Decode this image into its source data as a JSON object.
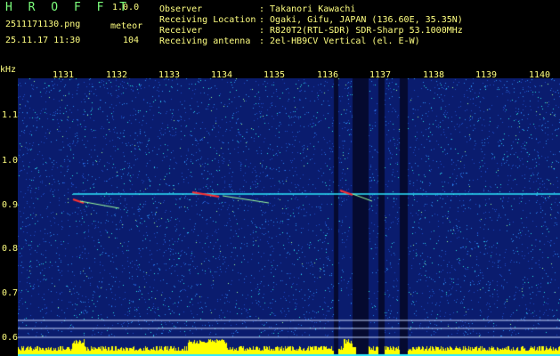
{
  "app": {
    "name": "H R O F F T",
    "version": "1.0.0"
  },
  "file": {
    "name": "2511171130.png",
    "datetime": "25.11.17 11:30"
  },
  "meteor": {
    "label": "meteor",
    "count": "104"
  },
  "metadata": [
    {
      "key": "Observer",
      "value": ": Takanori Kawachi"
    },
    {
      "key": "Receiving Location",
      "value": ": Ogaki, Gifu, JAPAN (136.60E, 35.35N)"
    },
    {
      "key": "Receiver",
      "value": ": R820T2(RTL-SDR) SDR-Sharp 53.1000MHz"
    },
    {
      "key": "Receiving antenna",
      "value": ": 2el-HB9CV Vertical (el. E-W)"
    }
  ],
  "y_axis": {
    "unit": "kHz",
    "ticks": [
      "1.1",
      "1.0",
      "0.9",
      "0.8",
      "0.7",
      "0.6"
    ]
  },
  "x_axis": {
    "ticks": [
      "1131",
      "1132",
      "1133",
      "1134",
      "1135",
      "1136",
      "1137",
      "1138",
      "1139",
      "1140"
    ]
  },
  "colors": {
    "background": "#0a1c6e",
    "text": "#ffff80",
    "title": "#7cff7c",
    "trace": "#2ee8ff",
    "meteor": "#ff3030",
    "level": "#ffff00"
  }
}
